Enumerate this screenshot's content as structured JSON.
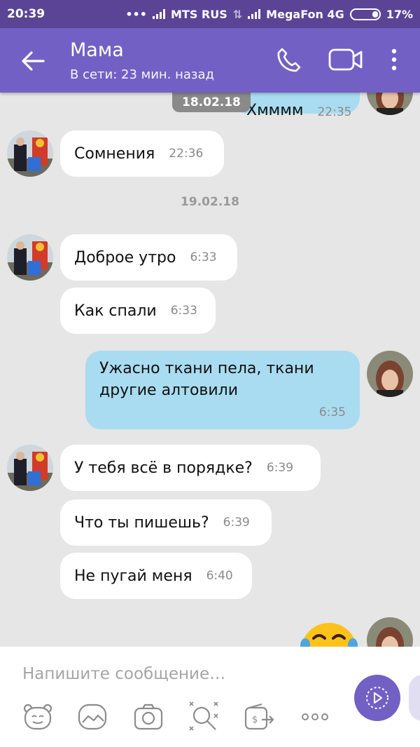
{
  "status_bar": {
    "time": "20:39",
    "carrier1": "MTS RUS",
    "carrier2": "MegaFon 4G",
    "battery": "17%"
  },
  "header": {
    "contact_name": "Мама",
    "status": "В сети: 23 мин. назад",
    "icons": [
      "back-arrow-icon",
      "phone-icon",
      "video-call-icon",
      "more-vertical-icon"
    ]
  },
  "chat": {
    "partial_outgoing": {
      "text": "Хмммм",
      "time": "22:35"
    },
    "date_pill": "18.02.18",
    "msg1": {
      "text": "Сомнения",
      "time": "22:36"
    },
    "date_sep": "19.02.18",
    "msg2": {
      "text": "Доброе утро",
      "time": "6:33"
    },
    "msg3": {
      "text": "Как спали",
      "time": "6:33"
    },
    "msg4": {
      "line1": "Ужасно ткани пела, ткани",
      "line2": "другие алтовили",
      "time": "6:35"
    },
    "msg5": {
      "text": "У тебя всё в порядке?",
      "time": "6:39"
    },
    "msg6": {
      "text": "Что ты пишешь?",
      "time": "6:39"
    },
    "msg7": {
      "text": "Не пугай меня",
      "time": "6:40"
    },
    "sticker": "laughing-emoji"
  },
  "composer": {
    "placeholder": "Напишите сообщение…",
    "icons": [
      "sticker-icon",
      "gallery-icon",
      "camera-icon",
      "doodle-icon",
      "money-transfer-icon",
      "more-horizontal-icon",
      "send-voice-icon"
    ]
  },
  "colors": {
    "status_bar": "#5b4496",
    "header": "#7360c4",
    "chat_bg": "#e6e6e6",
    "incoming": "#ffffff",
    "outgoing": "#a9dcf0",
    "accent": "#7360c4"
  }
}
